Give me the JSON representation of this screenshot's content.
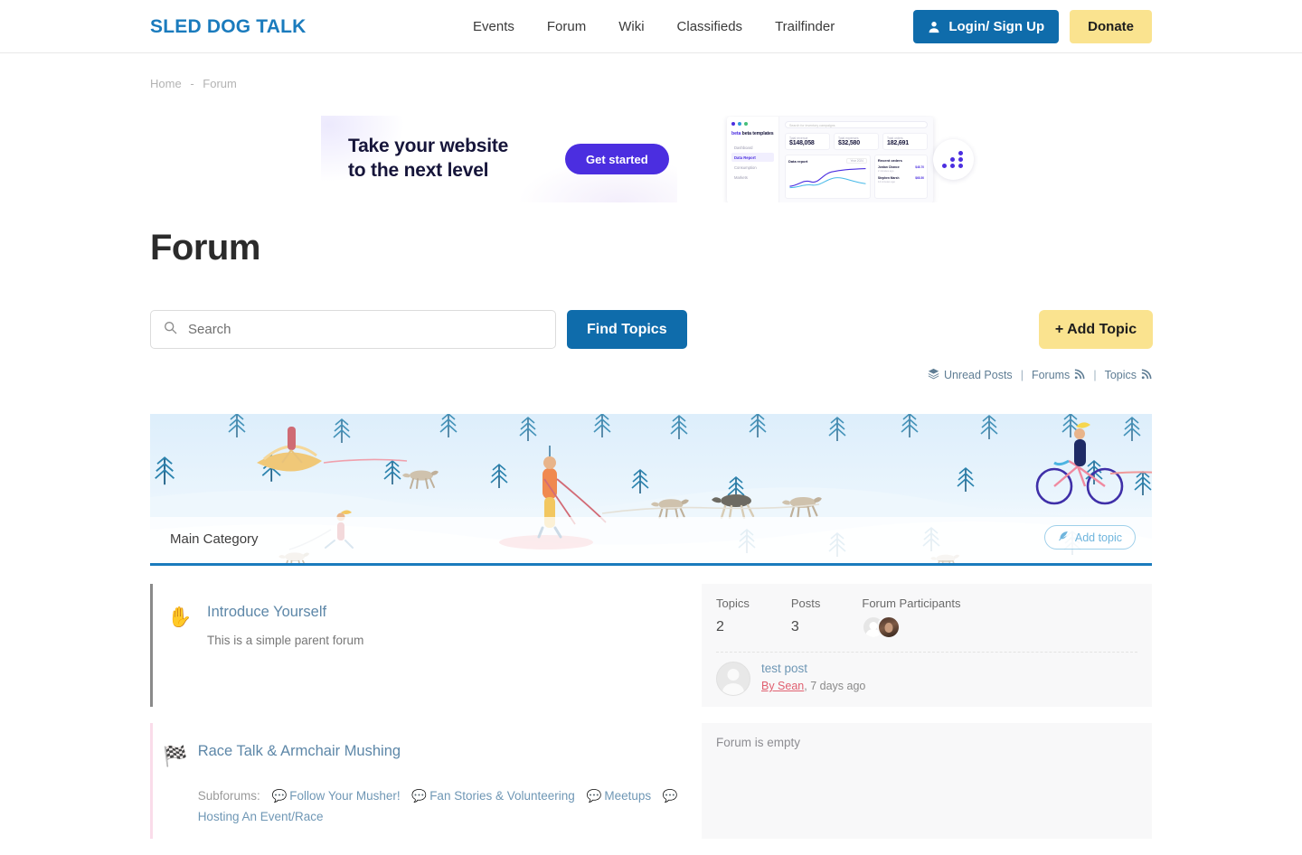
{
  "header": {
    "brand": "SLED DOG TALK",
    "nav": [
      {
        "label": "Events"
      },
      {
        "label": "Forum"
      },
      {
        "label": "Wiki"
      },
      {
        "label": "Classifieds"
      },
      {
        "label": "Trailfinder"
      }
    ],
    "login_label": "Login/ Sign Up",
    "donate_label": "Donate",
    "accent_blue": "#0f6cab",
    "accent_yellow": "#fae38f"
  },
  "breadcrumb": {
    "home": "Home",
    "separator": "-",
    "current": "Forum"
  },
  "ad": {
    "headline_line1": "Take your website",
    "headline_line2": "to the next level",
    "cta_label": "Get started",
    "accent": "#4b2ee0",
    "dashboard": {
      "logo": "beta templates",
      "search_placeholder": "Search for inventory campaigns",
      "nav": [
        {
          "label": "Dashboard",
          "active": false
        },
        {
          "label": "Data Report",
          "active": true
        },
        {
          "label": "Consumption",
          "active": false
        },
        {
          "label": "Markets",
          "active": false
        }
      ],
      "stats": [
        {
          "label": "Total revenue",
          "value": "$148,058"
        },
        {
          "label": "Total expenses",
          "value": "$32,580"
        },
        {
          "label": "Total orders",
          "value": "182,691"
        }
      ],
      "chart_title": "Data report",
      "chart_period": "Year 2024",
      "orders_title": "Recent orders",
      "orders": [
        {
          "name": "Jordan Chance",
          "date": "2 minutes ago",
          "amount": "$48.70"
        },
        {
          "name": "Stephen Marsh",
          "date": "14 minutes ago",
          "amount": "$68.50"
        }
      ]
    }
  },
  "page": {
    "title": "Forum"
  },
  "search": {
    "placeholder": "Search",
    "value": "",
    "find_label": "Find Topics",
    "add_topic_label": "+ Add Topic"
  },
  "feed_links": {
    "unread": "Unread Posts",
    "forums": "Forums",
    "topics": "Topics",
    "divider": "|"
  },
  "category": {
    "name": "Main Category",
    "add_topic_label": "Add topic"
  },
  "forums": [
    {
      "icon": "raised-hand-icon",
      "icon_glyph": "✋",
      "accent": "#8a8a8a",
      "title": "Introduce Yourself",
      "description": "This is a simple parent forum",
      "subforums_label": "",
      "subforums": [],
      "stats": {
        "topics_label": "Topics",
        "topics_value": "2",
        "posts_label": "Posts",
        "posts_value": "3",
        "participants_label": "Forum Participants",
        "participants_count": 2
      },
      "last_post": {
        "title": "test post",
        "by": "By Sean",
        "when": ", 7 days ago"
      },
      "empty_text": ""
    },
    {
      "icon": "checkered-flag-icon",
      "icon_glyph": "🏁",
      "accent": "#fadcea",
      "title": "Race Talk & Armchair Mushing",
      "description": "",
      "subforums_label": "Subforums:",
      "subforums": [
        {
          "label": "Follow Your Musher!"
        },
        {
          "label": "Fan Stories & Volunteering"
        },
        {
          "label": "Meetups"
        },
        {
          "label": "Hosting An Event/Race"
        }
      ],
      "stats": null,
      "last_post": null,
      "empty_text": "Forum is empty"
    }
  ]
}
